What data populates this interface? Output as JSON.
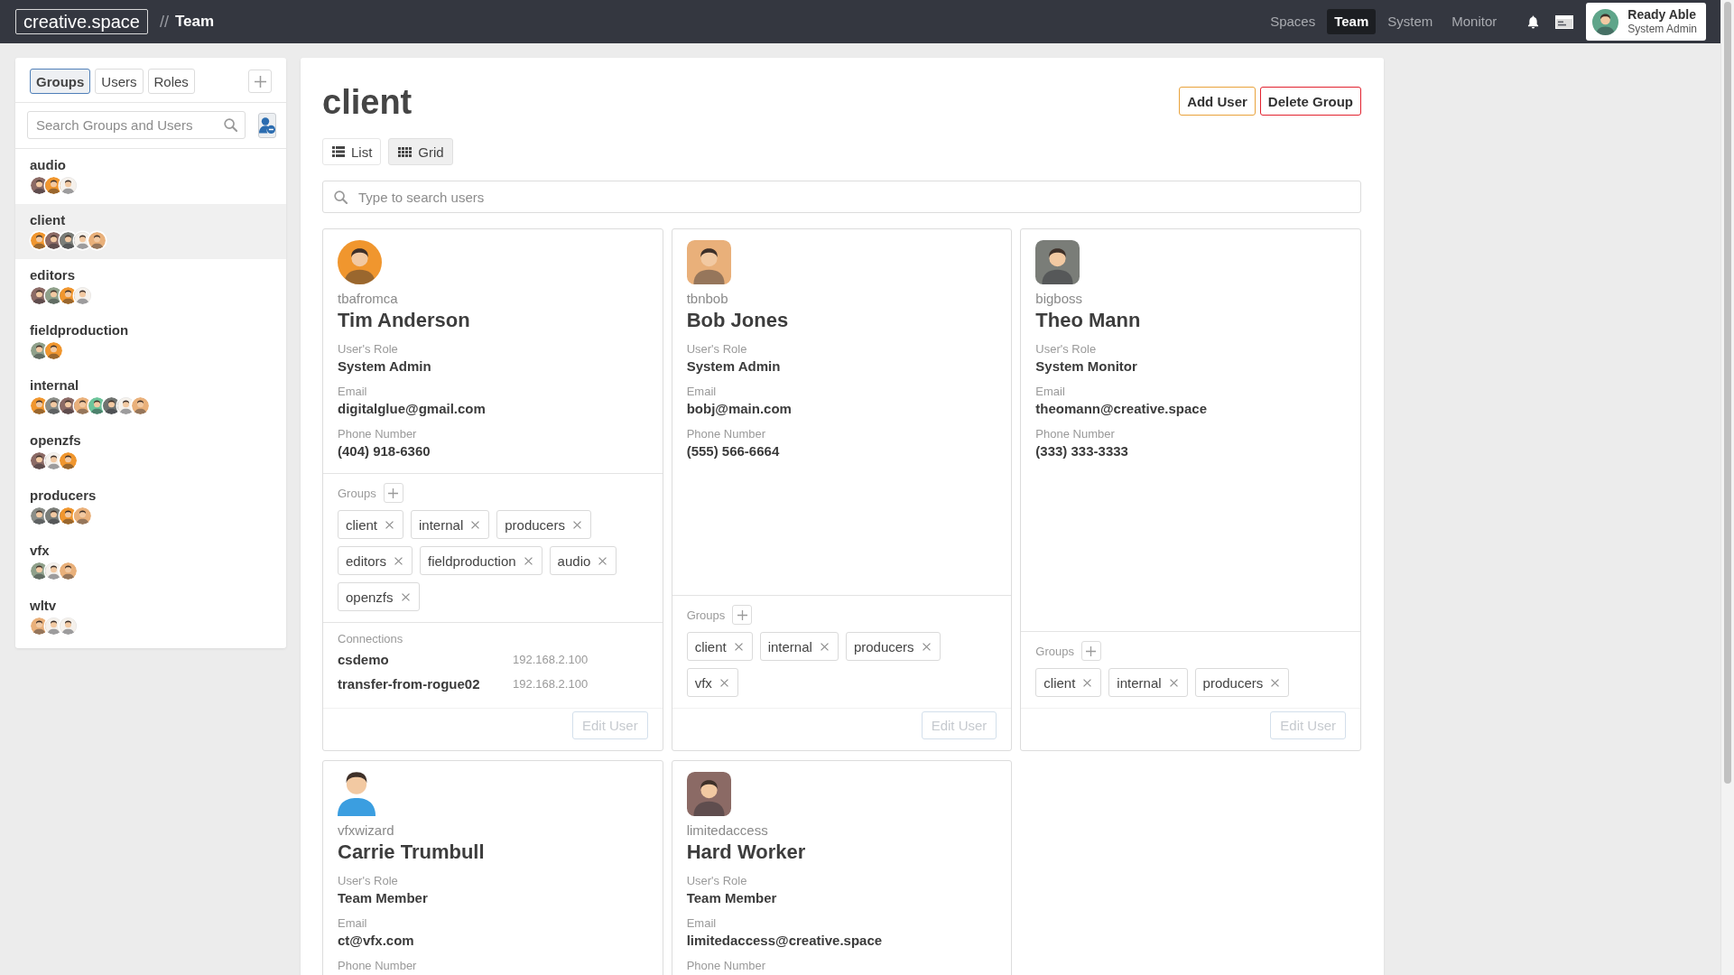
{
  "topbar": {
    "logo": "creative.space",
    "separator": "//",
    "section": "Team",
    "nav": [
      {
        "label": "Spaces",
        "selected": false
      },
      {
        "label": "Team",
        "selected": true
      },
      {
        "label": "System",
        "selected": false
      },
      {
        "label": "Monitor",
        "selected": false
      }
    ],
    "user": {
      "name": "Ready Able",
      "role": "System Admin",
      "avatar": {
        "color": "#5fa58a"
      }
    }
  },
  "sidebar": {
    "tabs": [
      {
        "label": "Groups",
        "selected": true
      },
      {
        "label": "Users",
        "selected": false
      },
      {
        "label": "Roles",
        "selected": false
      }
    ],
    "search": {
      "placeholder": "Search Groups and Users"
    },
    "groups": [
      {
        "name": "audio",
        "selected": false,
        "members": [
          {
            "color": "#8b6a65"
          },
          {
            "color": "#f0962e"
          },
          {
            "color": "#f5f1ec"
          }
        ]
      },
      {
        "name": "client",
        "selected": true,
        "members": [
          {
            "color": "#f0962e"
          },
          {
            "color": "#8b6a65"
          },
          {
            "color": "#7a7d78"
          },
          {
            "color": "#f5f1ec"
          },
          {
            "color": "#e9b07a"
          }
        ]
      },
      {
        "name": "editors",
        "selected": false,
        "members": [
          {
            "color": "#8b6a65"
          },
          {
            "color": "#8fa08a"
          },
          {
            "color": "#f0962e"
          },
          {
            "color": "#f5f1ec"
          }
        ]
      },
      {
        "name": "fieldproduction",
        "selected": false,
        "members": [
          {
            "color": "#8fa08a"
          },
          {
            "color": "#f0962e"
          }
        ]
      },
      {
        "name": "internal",
        "selected": false,
        "members": [
          {
            "color": "#f0962e"
          },
          {
            "color": "#8a8d88"
          },
          {
            "color": "#8b6a65"
          },
          {
            "color": "#e9b07a"
          },
          {
            "color": "#6cc49a"
          },
          {
            "color": "#6f7370"
          },
          {
            "color": "#f5f1ec"
          },
          {
            "color": "#e9b07a"
          }
        ]
      },
      {
        "name": "openzfs",
        "selected": false,
        "members": [
          {
            "color": "#8b6a65"
          },
          {
            "color": "#f5f1ec"
          },
          {
            "color": "#f0962e"
          }
        ]
      },
      {
        "name": "producers",
        "selected": false,
        "members": [
          {
            "color": "#8a8d88"
          },
          {
            "color": "#7a7d78"
          },
          {
            "color": "#f0962e"
          },
          {
            "color": "#e9b07a"
          }
        ]
      },
      {
        "name": "vfx",
        "selected": false,
        "members": [
          {
            "color": "#8fa08a"
          },
          {
            "color": "#f5f1ec"
          },
          {
            "color": "#e9b07a"
          }
        ]
      },
      {
        "name": "wltv",
        "selected": false,
        "members": [
          {
            "color": "#e9b07a"
          },
          {
            "color": "#f5f1ec"
          },
          {
            "color": "#f5f1ec"
          }
        ]
      }
    ]
  },
  "main": {
    "title": "client",
    "buttons": [
      {
        "label": "Add User",
        "kind": "add"
      },
      {
        "label": "Delete Group",
        "kind": "delete"
      }
    ],
    "views": [
      {
        "label": "List",
        "kind": "list",
        "selected": false
      },
      {
        "label": "Grid",
        "kind": "grid",
        "selected": true
      }
    ],
    "search": {
      "placeholder": "Type to search users"
    },
    "cards": [
      {
        "avatar": {
          "kind": "circle",
          "color": "#f0962e"
        },
        "username": "tbafromca",
        "name": "Tim Anderson",
        "fields": [
          {
            "label": "User's Role",
            "value": "System Admin"
          },
          {
            "label": "Email",
            "value": "digitalglue@gmail.com"
          },
          {
            "label": "Phone Number",
            "value": "(404) 918-6360"
          }
        ],
        "groups_label": "Groups",
        "groups": [
          "client",
          "internal",
          "producers",
          "editors",
          "fieldproduction",
          "audio",
          "openzfs"
        ],
        "connections_label": "Connections",
        "connections": [
          {
            "name": "csdemo",
            "address": "192.168.2.100"
          },
          {
            "name": "transfer-from-rogue02",
            "address": "192.168.2.100"
          }
        ],
        "action": {
          "label": "Edit User",
          "disabled": true
        }
      },
      {
        "avatar": {
          "kind": "rounded",
          "color": "#e9b07a"
        },
        "username": "tbnbob",
        "name": "Bob Jones",
        "fields": [
          {
            "label": "User's Role",
            "value": "System Admin"
          },
          {
            "label": "Email",
            "value": "bobj@main.com"
          },
          {
            "label": "Phone Number",
            "value": "(555) 566-6664"
          }
        ],
        "groups_label": "Groups",
        "groups": [
          "client",
          "internal",
          "producers",
          "vfx"
        ],
        "action": {
          "label": "Edit User",
          "disabled": true
        }
      },
      {
        "avatar": {
          "kind": "rounded",
          "color": "#7a7d78"
        },
        "username": "bigboss",
        "name": "Theo Mann",
        "fields": [
          {
            "label": "User's Role",
            "value": "System Monitor"
          },
          {
            "label": "Email",
            "value": "theomann@creative.space"
          },
          {
            "label": "Phone Number",
            "value": "(333) 333-3333"
          }
        ],
        "groups_label": "Groups",
        "groups": [
          "client",
          "internal",
          "producers"
        ],
        "action": {
          "label": "Edit User",
          "disabled": true
        }
      },
      {
        "avatar": {
          "kind": "bare",
          "color": "#3b9ee0"
        },
        "username": "vfxwizard",
        "name": "Carrie Trumbull",
        "fields": [
          {
            "label": "User's Role",
            "value": "Team Member"
          },
          {
            "label": "Email",
            "value": "ct@vfx.com"
          },
          {
            "label": "Phone Number"
          }
        ]
      },
      {
        "avatar": {
          "kind": "rounded",
          "color": "#8b6a65"
        },
        "username": "limitedaccess",
        "name": "Hard Worker",
        "fields": [
          {
            "label": "User's Role",
            "value": "Team Member"
          },
          {
            "label": "Email",
            "value": "limitedaccess@creative.space"
          },
          {
            "label": "Phone Number"
          }
        ]
      }
    ]
  }
}
